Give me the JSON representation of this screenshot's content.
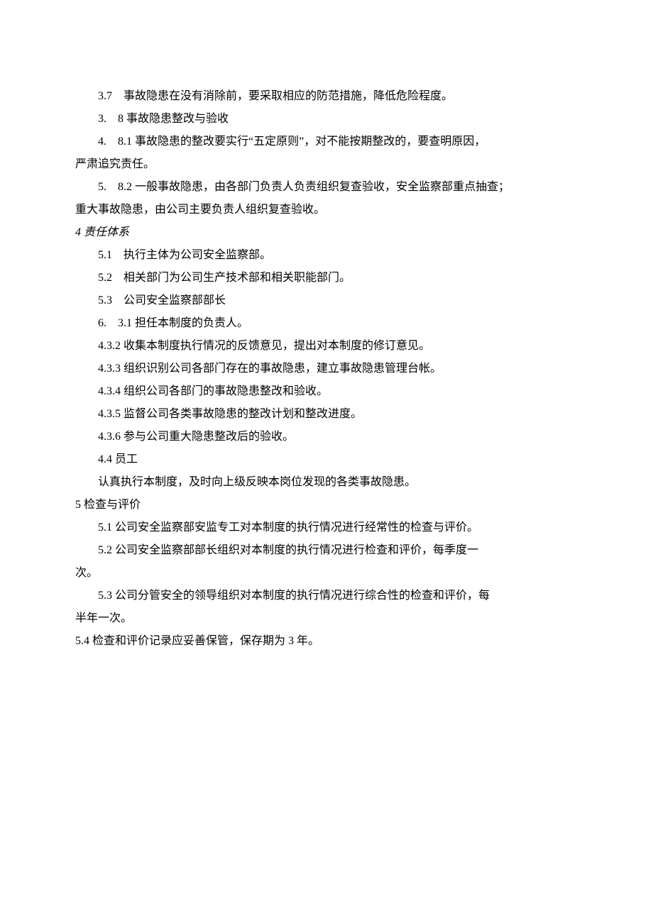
{
  "lines": [
    {
      "cls": "para",
      "text": "3.7　事故隐患在没有消除前，要采取相应的防范措施，降低危险程度。"
    },
    {
      "cls": "para",
      "text": "3.　8 事故隐患整改与验收"
    },
    {
      "cls": "para",
      "text": "4.　8.1 事故隐患的整改要实行“五定原则”，对不能按期整改的，要查明原因，"
    },
    {
      "cls": "para-continue",
      "text": "严肃追究责任。"
    },
    {
      "cls": "para",
      "text": "5.　8.2 一般事故隐患，由各部门负责人负责组织复查验收，安全监察部重点抽查；"
    },
    {
      "cls": "para-continue",
      "text": "重大事故隐患，由公司主要负责人组织复查验收。"
    },
    {
      "cls": "para-heading",
      "text": "4 责任体系"
    },
    {
      "cls": "para",
      "text": "5.1　执行主体为公司安全监察部。"
    },
    {
      "cls": "para",
      "text": "5.2　相关部门为公司生产技术部和相关职能部门。"
    },
    {
      "cls": "para",
      "text": "5.3　公司安全监察部部长"
    },
    {
      "cls": "para",
      "text": "6.　3.1 担任本制度的负责人。"
    },
    {
      "cls": "para",
      "text": "4.3.2 收集本制度执行情况的反馈意见，提出对本制度的修订意见。"
    },
    {
      "cls": "para",
      "text": "4.3.3 组织识别公司各部门存在的事故隐患，建立事故隐患管理台帐。"
    },
    {
      "cls": "para",
      "text": "4.3.4 组织公司各部门的事故隐患整改和验收。"
    },
    {
      "cls": "para",
      "text": "4.3.5 监督公司各类事故隐患的整改计划和整改进度。"
    },
    {
      "cls": "para",
      "text": "4.3.6 参与公司重大隐患整改后的验收。"
    },
    {
      "cls": "para",
      "text": "4.4 员工"
    },
    {
      "cls": "para",
      "text": "认真执行本制度，及时向上级反映本岗位发现的各类事故隐患。"
    },
    {
      "cls": "para-no-indent",
      "text": "5 检查与评价"
    },
    {
      "cls": "para",
      "text": "5.1 公司安全监察部安监专工对本制度的执行情况进行经常性的检查与评价。"
    },
    {
      "cls": "para",
      "text": "5.2 公司安全监察部部长组织对本制度的执行情况进行检查和评价，每季度一"
    },
    {
      "cls": "para-continue",
      "text": "次。"
    },
    {
      "cls": "para",
      "text": "5.3 公司分管安全的领导组织对本制度的执行情况进行综合性的检查和评价，每"
    },
    {
      "cls": "para-continue",
      "text": "半年一次。"
    },
    {
      "cls": "para-no-indent",
      "text": "5.4 检查和评价记录应妥善保管，保存期为 3 年。"
    }
  ]
}
